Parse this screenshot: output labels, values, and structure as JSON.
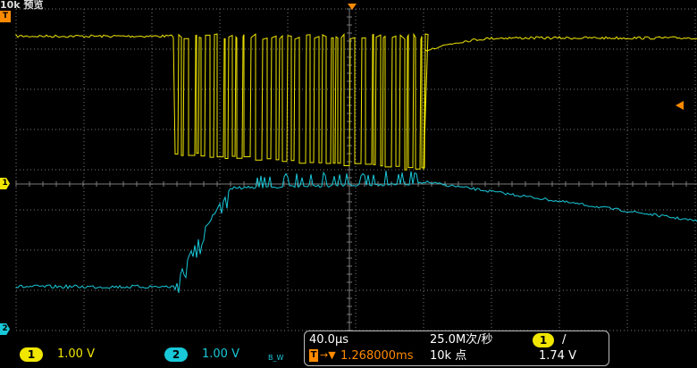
{
  "header": {
    "title": "10k 预览"
  },
  "markers": {
    "trigger": "T",
    "ch1": "1",
    "ch2": "2"
  },
  "channels": [
    {
      "id": "1",
      "scale": "1.00 V",
      "color": "#f0e600"
    },
    {
      "id": "2",
      "scale": "1.00 V",
      "color": "#18c8d8",
      "bw_icon": "B_W"
    }
  ],
  "timebase": {
    "scale": "40.0µs",
    "sample_rate": "25.0M次/秒",
    "trigger_delay": "1.268000ms",
    "record_length": "10k 点"
  },
  "trigger": {
    "source": "1",
    "slope_icon": "/",
    "level": "1.74 V",
    "color": "#ff8a00"
  },
  "colors": {
    "grid": "#7a7a7a",
    "background": "#000000"
  }
}
